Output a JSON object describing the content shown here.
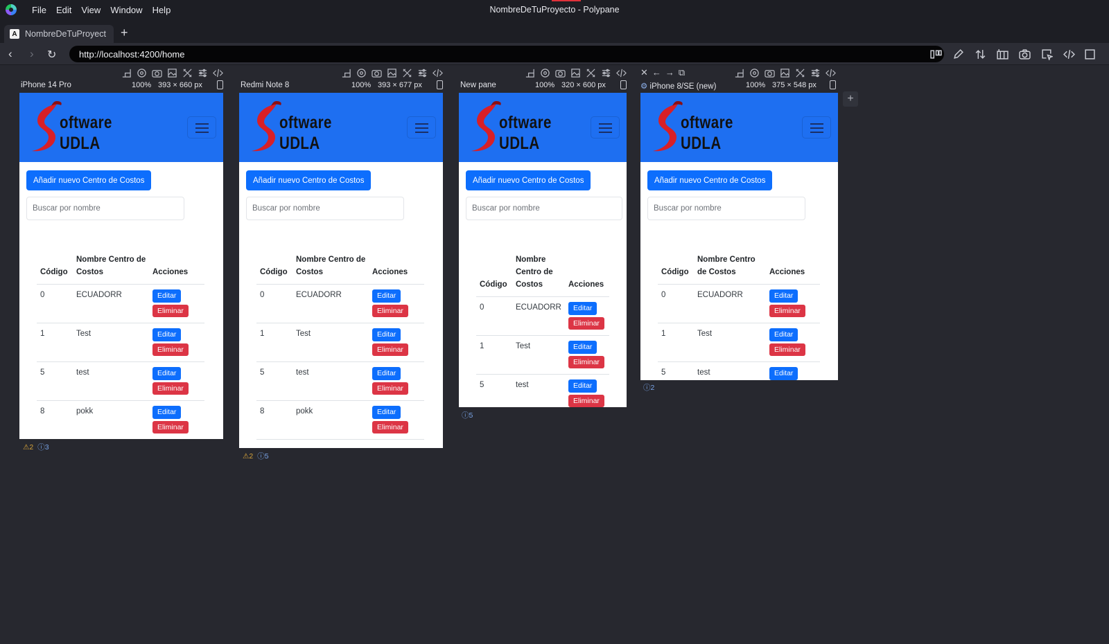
{
  "menubar": {
    "items": [
      "File",
      "Edit",
      "View",
      "Window",
      "Help"
    ],
    "window_title": "NombreDeTuProyecto - Polypane"
  },
  "tab": {
    "label": "NombreDeTuProyect",
    "favicon": "A",
    "new_tab": "+"
  },
  "address": {
    "url": "http://localhost:4200/home"
  },
  "panes": [
    {
      "name": "iPhone 14 Pro",
      "zoom": "100%",
      "dims": "393 × 660 px",
      "warnings": "2",
      "infos": "3"
    },
    {
      "name": "Redmi Note 8",
      "zoom": "100%",
      "dims": "393 × 677 px",
      "warnings": "2",
      "infos": "5"
    },
    {
      "name": "New pane",
      "zoom": "100%",
      "dims": "320 × 600 px",
      "infos": "5"
    },
    {
      "name": "iPhone 8/SE (new)",
      "zoom": "100%",
      "dims": "375 × 548 px",
      "infos": "2"
    }
  ],
  "app": {
    "logo_line1": "oftware",
    "logo_line2": "UDLA",
    "add_button": "Añadir nuevo Centro de Costos",
    "search_placeholder": "Buscar por nombre",
    "col_code": "Código",
    "col_name": "Nombre Centro de Costos",
    "col_actions": "Acciones",
    "edit_label": "Editar",
    "delete_label": "Eliminar",
    "rows": [
      {
        "code": "0",
        "name": "ECUADORR"
      },
      {
        "code": "1",
        "name": "Test"
      },
      {
        "code": "5",
        "name": "test"
      },
      {
        "code": "8",
        "name": "pokk"
      }
    ]
  },
  "add_pane_label": "+",
  "colors": {
    "nav_blue": "#1e6ff1",
    "primary": "#0d6efd",
    "danger": "#dc3545",
    "chrome_bg": "#27282f"
  }
}
